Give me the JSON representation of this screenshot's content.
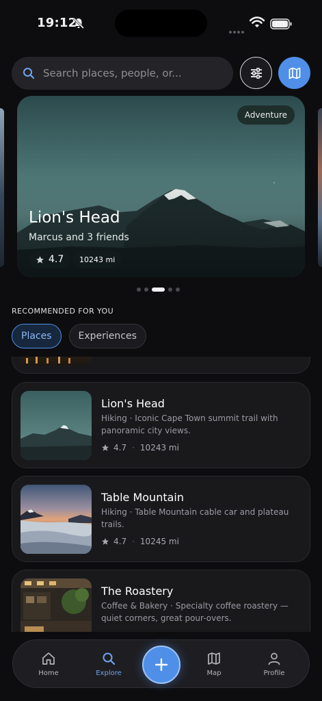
{
  "status_bar": {
    "time": "19:12"
  },
  "search": {
    "placeholder": "Search places, people, or..."
  },
  "featured": {
    "tag": "Adventure",
    "title": "Lion's Head",
    "subtitle": "Marcus and 3 friends",
    "rating": "4.7",
    "distance": "10243 mi",
    "dots_total": 5,
    "active_dot": 2
  },
  "section": {
    "title": "RECOMMENDED FOR YOU",
    "tabs": [
      {
        "label": "Places"
      },
      {
        "label": "Experiences"
      }
    ],
    "active_tab": "Places"
  },
  "places": [
    {
      "name": "Lion's Head",
      "description": "Hiking · Iconic Cape Town summit trail with panoramic city views.",
      "rating": "4.7",
      "distance": "10243 mi"
    },
    {
      "name": "Table Mountain",
      "description": "Hiking · Table Mountain cable car and plateau trails.",
      "rating": "4.7",
      "distance": "10245 mi"
    },
    {
      "name": "The Roastery",
      "description": "Coffee & Bakery · Specialty coffee roastery — quiet corners, great pour-overs.",
      "rating": "",
      "distance": ""
    }
  ],
  "nav": {
    "items": [
      {
        "label": "Home"
      },
      {
        "label": "Explore"
      },
      {
        "label": "Map"
      },
      {
        "label": "Profile"
      }
    ],
    "active": "Explore"
  },
  "colors": {
    "accent": "#4f8fe8",
    "background": "#0d0d0f",
    "card": "#19191c"
  }
}
